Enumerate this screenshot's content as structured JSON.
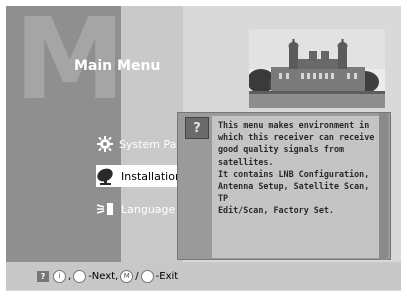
{
  "screen": {
    "watermark_letter": "M",
    "title": "Main Menu"
  },
  "menu": {
    "items": [
      {
        "label": "System Para",
        "icon": "gear-icon",
        "selected": false
      },
      {
        "label": "Installation",
        "icon": "satellite-dish-icon",
        "selected": true
      },
      {
        "label": "Language",
        "icon": "language-icon",
        "selected": false
      }
    ]
  },
  "info_panel": {
    "icon": "help-icon",
    "icon_glyph": "?",
    "lines": [
      "This menu makes environment in",
      "which this receiver can receive",
      "good quality signals from satellites.",
      " It contains LNB Configuration,",
      "Antenna Setup, Satellite Scan, TP",
      "Edit/Scan, Factory Set."
    ]
  },
  "footer": {
    "sep1": ",",
    "next_label": "-Next,",
    "sep2": "/",
    "exit_label": "-Exit"
  },
  "colors": {
    "frame": "#d9d9d9",
    "left_panel": "#8f8f8f",
    "highlight": "#ffffff",
    "info_box": "#c4c4c4"
  }
}
